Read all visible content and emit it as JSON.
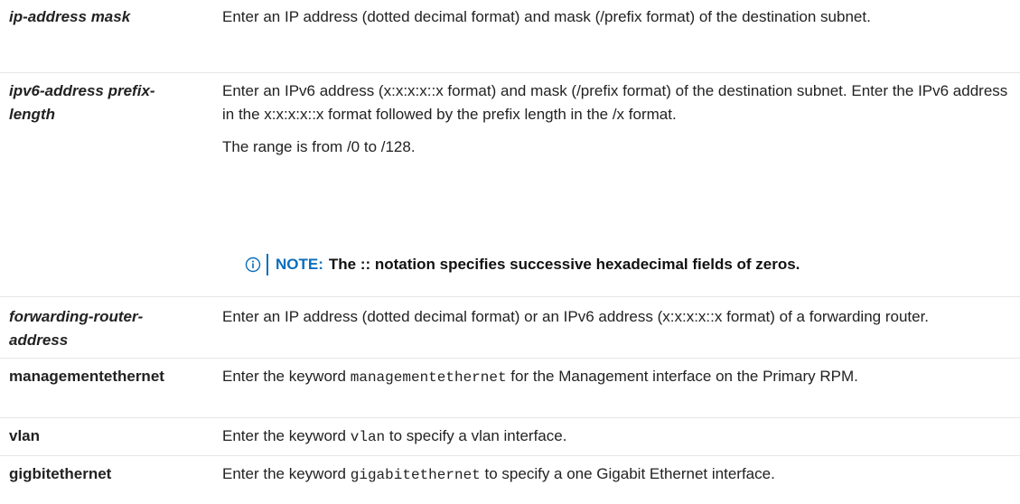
{
  "rows": [
    {
      "param": "ip-address mask",
      "desc": "Enter an IP address (dotted decimal format) and mask (/prefix format) of the destination subnet."
    },
    {
      "param": "ipv6-address prefix-length",
      "desc1": "Enter an IPv6 address (x:x:x:x::x format) and mask (/prefix format) of the destination subnet. Enter the IPv6 address in the x:x:x:x::x format followed by the prefix length in the /x format.",
      "desc2": "The range is from /0 to /128."
    },
    {
      "param": "forwarding-router-address",
      "desc": "Enter an IP address (dotted decimal format) or an IPv6 address (x:x:x:x::x format) of a forwarding router."
    },
    {
      "param": "managementethernet",
      "desc_pre": "Enter the keyword ",
      "desc_code": "managementethernet",
      "desc_post": " for the Management interface on the Primary RPM."
    },
    {
      "param": "vlan",
      "desc_pre": "Enter the keyword ",
      "desc_code": "vlan",
      "desc_post": " to specify a vlan interface."
    },
    {
      "param": "gigbitethernet",
      "desc_pre": "Enter the keyword ",
      "desc_code": "gigabitethernet",
      "desc_post": " to specify a one Gigabit Ethernet interface."
    }
  ],
  "note": {
    "label": "NOTE:",
    "text": "The :: notation specifies successive hexadecimal fields of zeros.",
    "icon": "info-icon",
    "accent_color": "#0a6ebd"
  }
}
